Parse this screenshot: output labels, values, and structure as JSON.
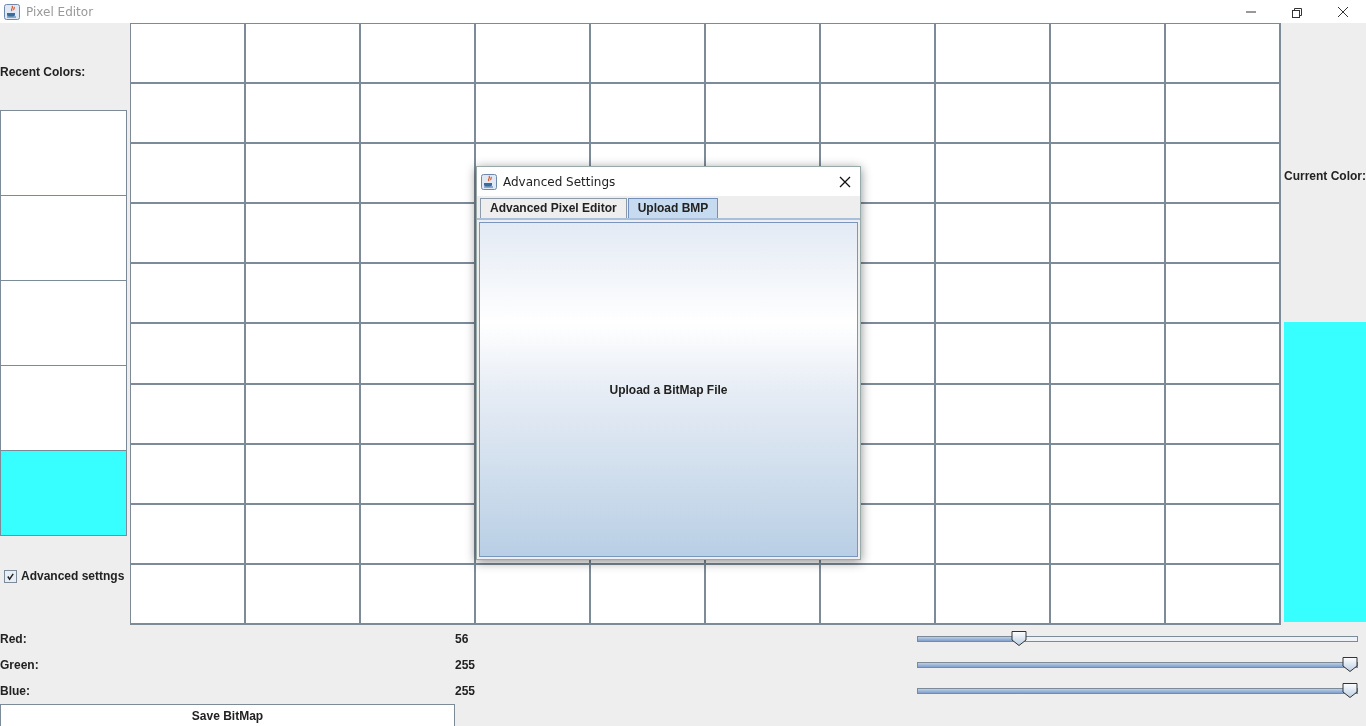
{
  "window": {
    "title": "Pixel Editor"
  },
  "recent_colors": {
    "label": "Recent Colors:",
    "swatches": [
      {
        "color": "#ffffff"
      },
      {
        "color": "#ffffff"
      },
      {
        "color": "#ffffff"
      },
      {
        "color": "#ffffff"
      },
      {
        "color": "#38ffff"
      }
    ]
  },
  "advanced_checkbox": {
    "label": "Advanced settngs",
    "checked": true
  },
  "current_color": {
    "label": "Current Color:",
    "color": "#38ffff"
  },
  "channels": [
    {
      "name": "Red:",
      "reading": "56",
      "level": 0.22
    },
    {
      "name": "Green:",
      "reading": "255",
      "level": 1
    },
    {
      "name": "Blue:",
      "reading": "255",
      "level": 1
    }
  ],
  "save_button": {
    "label": "Save BitMap"
  },
  "dialog": {
    "title": "Advanced Settings",
    "tabs": [
      {
        "label": "Advanced Pixel Editor",
        "selected": false
      },
      {
        "label": "Upload BMP",
        "selected": true
      }
    ],
    "button": {
      "label": "Upload a BitMap File"
    }
  }
}
